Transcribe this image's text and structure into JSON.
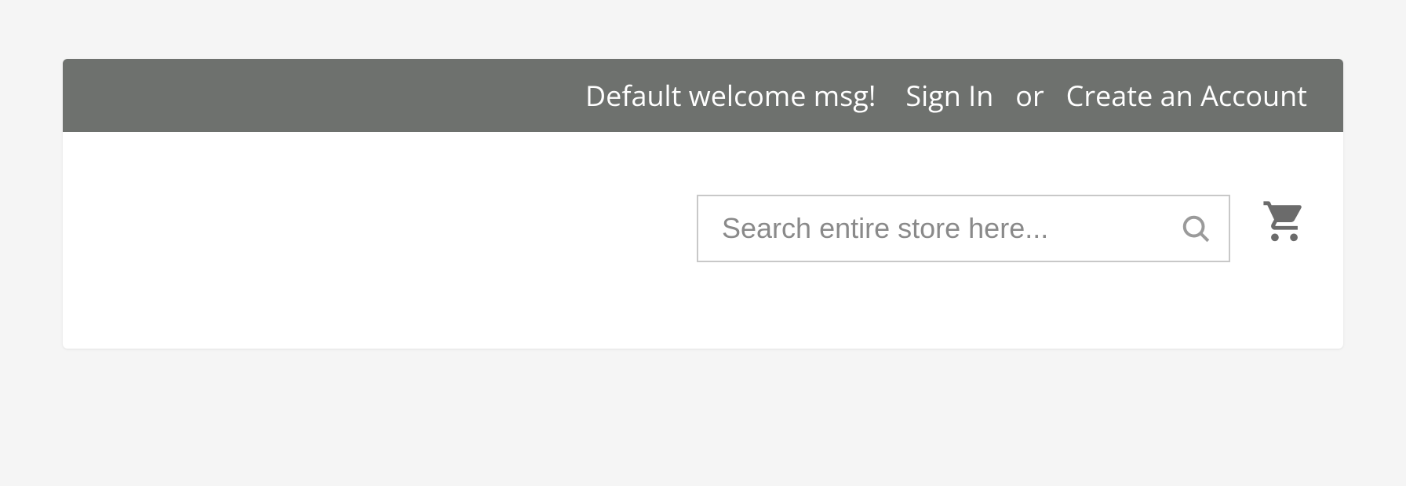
{
  "header": {
    "welcome_message": "Default welcome msg!",
    "sign_in_label": "Sign In",
    "separator": "or",
    "create_account_label": "Create an Account"
  },
  "search": {
    "placeholder": "Search entire store here...",
    "value": ""
  }
}
